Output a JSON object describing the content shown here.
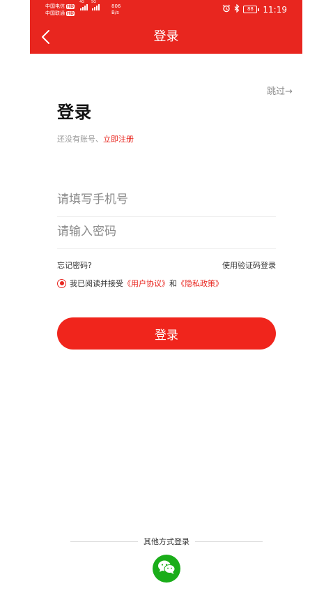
{
  "status_bar": {
    "carrier1": "中国电信",
    "carrier2": "中国联通",
    "hd_label": "HD",
    "net1": "4G",
    "net2": "5G",
    "speed_value": "806",
    "speed_unit": "B/s",
    "battery": "88",
    "time": "11:19"
  },
  "header": {
    "title": "登录",
    "back_icon": "chevron-left-icon"
  },
  "skip": "跳过→",
  "page_title": "登录",
  "register": {
    "prefix": "还没有账号、",
    "link": "立即注册"
  },
  "form": {
    "phone_placeholder": "请填写手机号",
    "password_placeholder": "请输入密码"
  },
  "links": {
    "forgot": "忘记密码?",
    "sms_login": "使用验证码登录"
  },
  "agreement": {
    "prefix": "我已阅读并接受",
    "user_agreement": "《用户协议》",
    "and": "和",
    "privacy_policy": "《隐私政策》",
    "checked": true
  },
  "login_button": "登录",
  "other_login": "其他方式登录",
  "wechat_icon": "wechat-icon",
  "colors": {
    "accent": "#e8261f",
    "button": "#f0251c",
    "wechat": "#1aad19"
  }
}
